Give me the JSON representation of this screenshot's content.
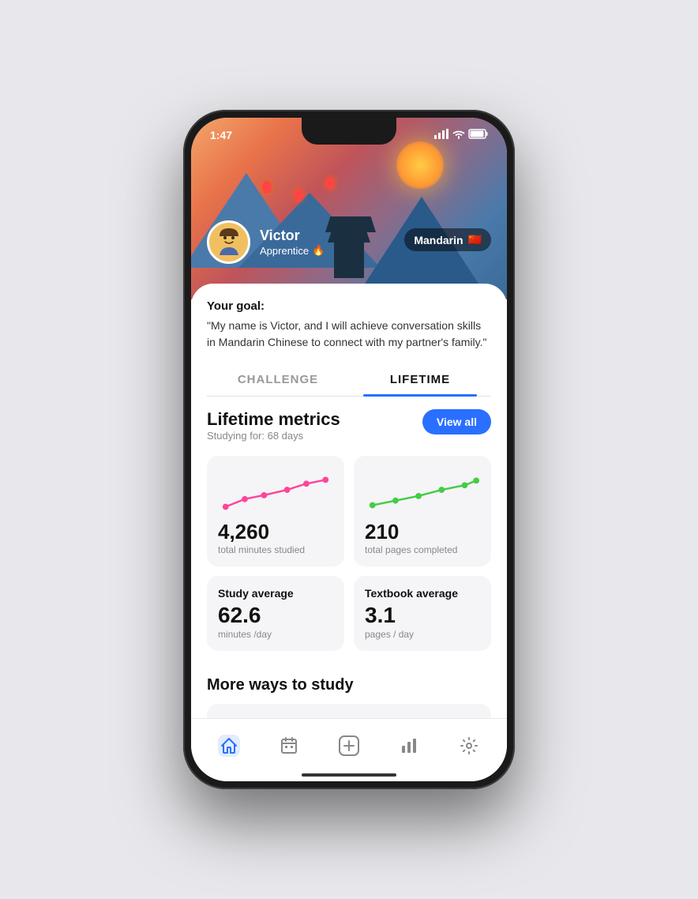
{
  "statusBar": {
    "time": "1:47",
    "icons": [
      "signal",
      "wifi",
      "battery"
    ]
  },
  "profile": {
    "name": "Victor",
    "level": "Apprentice",
    "levelEmoji": "🔥",
    "avatar": "👦"
  },
  "language": {
    "name": "Mandarin",
    "flag": "🇨🇳"
  },
  "goal": {
    "label": "Your goal:",
    "text": "\"My name is Victor, and I will achieve conversation skills in Mandarin Chinese to connect with my partner's family.\""
  },
  "tabs": {
    "challenge": "CHALLENGE",
    "lifetime": "LIFETIME",
    "activeTab": "lifetime"
  },
  "metrics": {
    "title": "Lifetime metrics",
    "studyingFor": "Studying for: 68 days",
    "viewAllLabel": "View all",
    "card1": {
      "value": "4,260",
      "label": "total minutes studied"
    },
    "card2": {
      "value": "210",
      "label": "total pages completed"
    },
    "stat1": {
      "title": "Study average",
      "value": "62.6",
      "unit": "minutes /day"
    },
    "stat2": {
      "title": "Textbook average",
      "value": "3.1",
      "unit": "pages / day"
    }
  },
  "moreStudy": {
    "title": "More ways to study"
  },
  "bottomNav": {
    "items": [
      {
        "name": "home",
        "icon": "home",
        "active": true
      },
      {
        "name": "calendar",
        "icon": "calendar",
        "active": false
      },
      {
        "name": "add",
        "icon": "plus",
        "active": false
      },
      {
        "name": "stats",
        "icon": "bar-chart",
        "active": false
      },
      {
        "name": "settings",
        "icon": "gear",
        "active": false
      }
    ]
  }
}
